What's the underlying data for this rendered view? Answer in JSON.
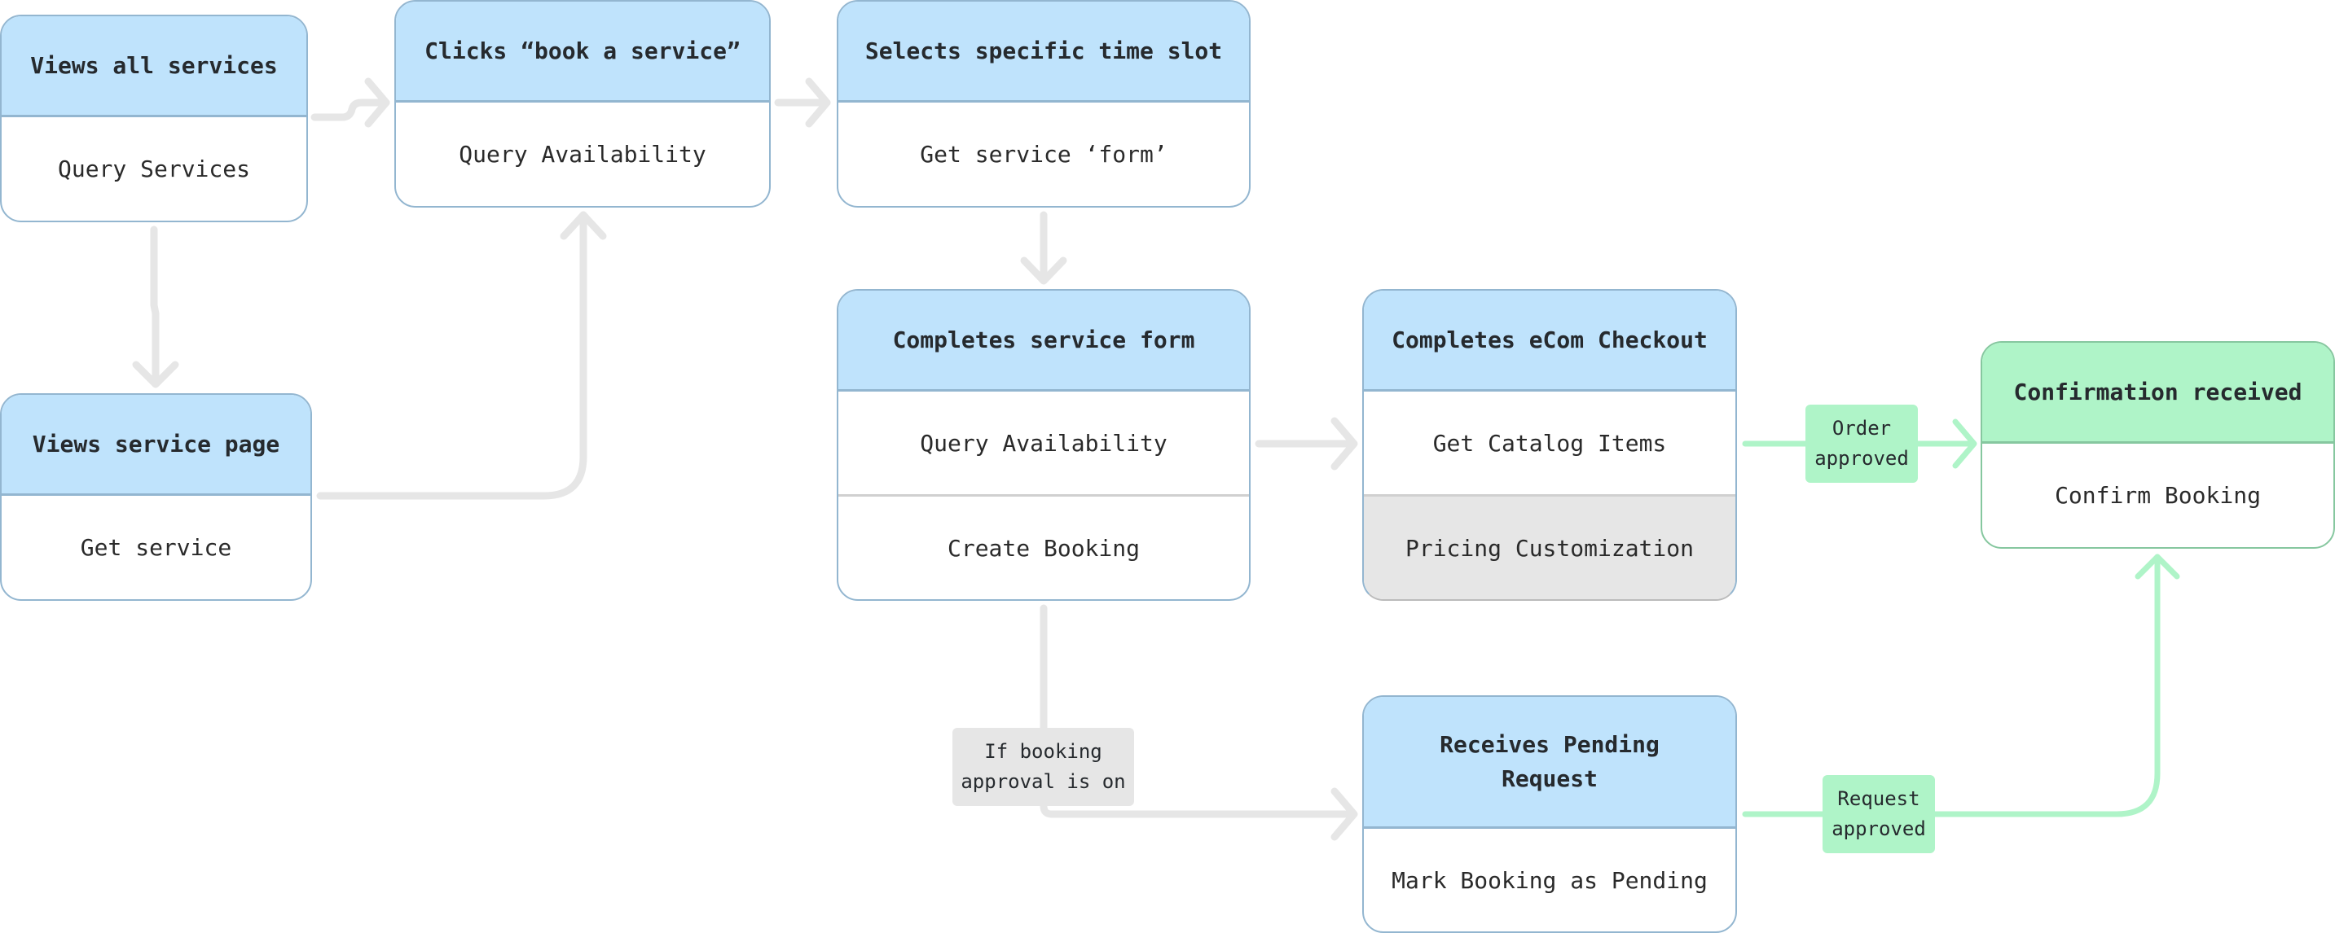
{
  "colors": {
    "header_blue": "#bfe3fc",
    "header_green": "#aff4c8",
    "connector_gray": "#e6e6e6",
    "connector_green": "#aff4c8",
    "disabled_row": "#e6e6e6"
  },
  "nodes": {
    "views_all_services": {
      "title": "Views all services",
      "rows": [
        "Query Services"
      ]
    },
    "clicks_book": {
      "title": "Clicks “book a service”",
      "rows": [
        "Query Availability"
      ]
    },
    "selects_slot": {
      "title": "Selects specific time slot",
      "rows": [
        "Get service ‘form’"
      ]
    },
    "views_service_page": {
      "title": "Views service page",
      "rows": [
        "Get service"
      ]
    },
    "completes_form": {
      "title": "Completes service form",
      "rows": [
        "Query Availability",
        "Create Booking"
      ]
    },
    "ecom_checkout": {
      "title": "Completes eCom Checkout",
      "rows": [
        "Get Catalog Items",
        "Pricing Customization"
      ]
    },
    "confirmation": {
      "title": "Confirmation received",
      "rows": [
        "Confirm Booking"
      ]
    },
    "pending_request": {
      "title": "Receives Pending Request",
      "rows": [
        "Mark Booking as Pending"
      ]
    }
  },
  "labels": {
    "order_approved": "Order approved",
    "request_approved": "Request approved",
    "booking_approval": "If booking approval is on"
  }
}
